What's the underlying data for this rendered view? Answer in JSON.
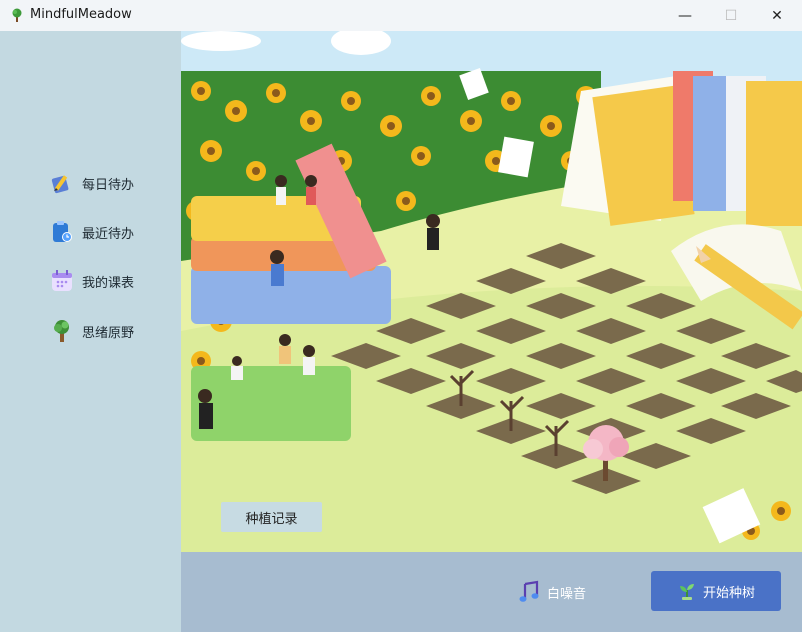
{
  "window": {
    "title": "MindfulMeadow",
    "controls": {
      "minimize": "—",
      "maximize": "☐",
      "close": "✕"
    }
  },
  "sidebar": {
    "items": [
      {
        "label": "每日待办",
        "icon": "pencil-note-icon"
      },
      {
        "label": "最近待办",
        "icon": "clipboard-clock-icon"
      },
      {
        "label": "我的课表",
        "icon": "calendar-icon"
      },
      {
        "label": "思绪原野",
        "icon": "tree-icon"
      }
    ]
  },
  "scene": {
    "plant_record_label": "种植记录"
  },
  "bottombar": {
    "white_noise_label": "白噪音",
    "start_planting_label": "开始种树"
  },
  "colors": {
    "sidebar_bg": "#c3d9e1",
    "bottombar_bg": "#a7bcd0",
    "primary_button": "#4a72c7"
  }
}
